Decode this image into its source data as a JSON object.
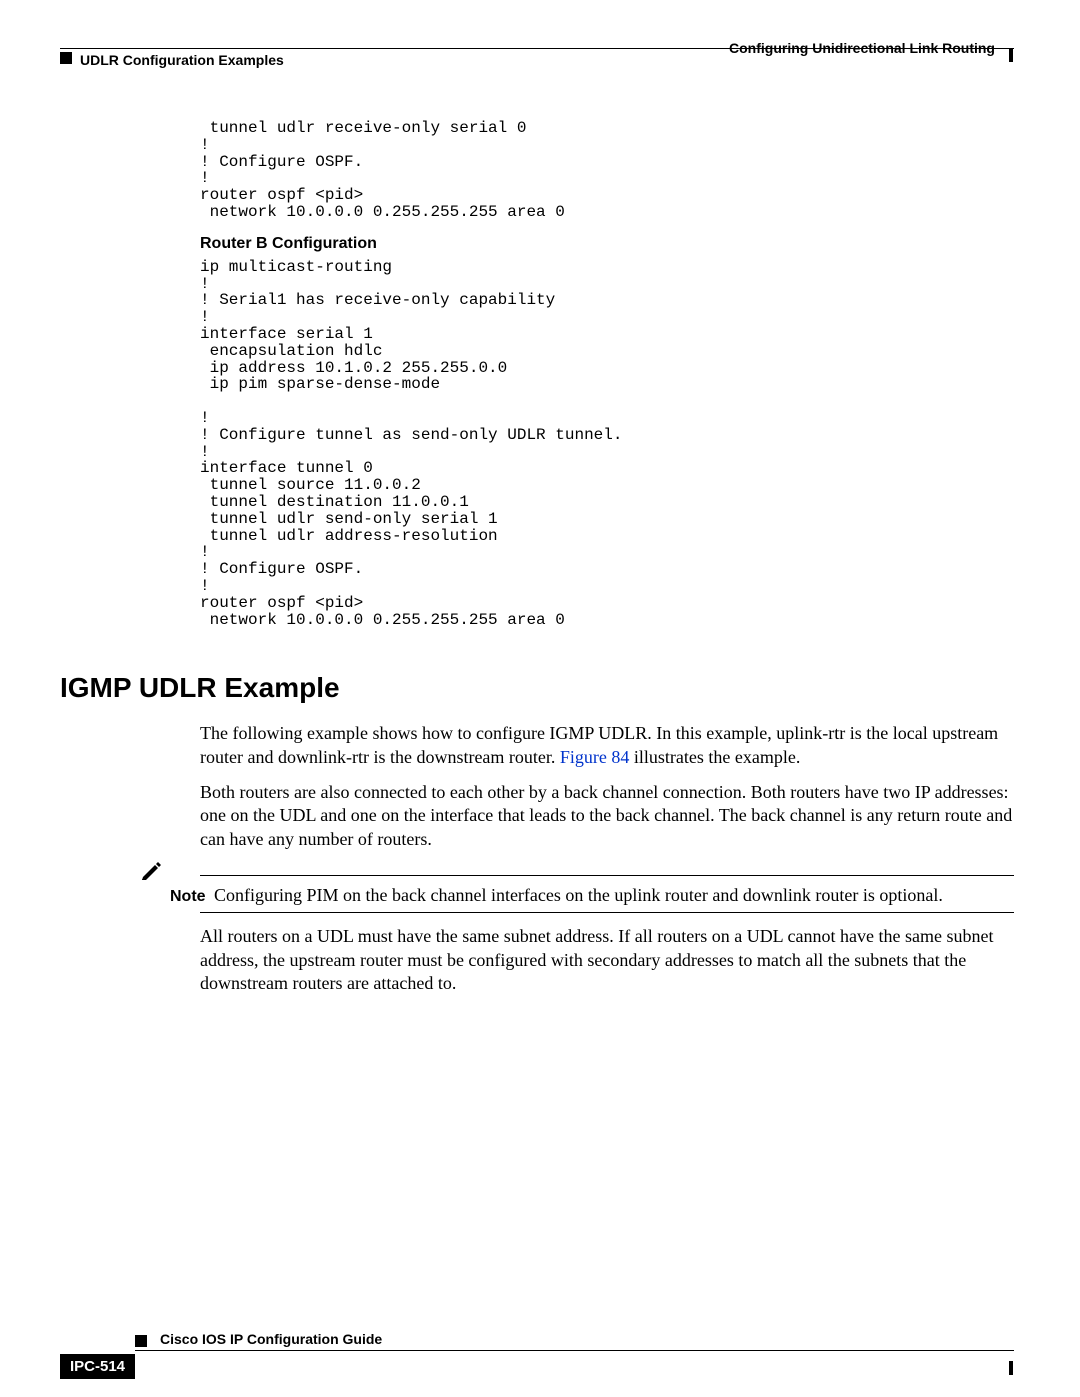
{
  "header": {
    "chapter": "Configuring Unidirectional Link Routing",
    "section": "UDLR Configuration Examples"
  },
  "code": {
    "blockA": " tunnel udlr receive-only serial 0\n!\n! Configure OSPF.\n!\nrouter ospf <pid>\n network 10.0.0.0 0.255.255.255 area 0",
    "routerB_heading": "Router B Configuration",
    "blockB": "ip multicast-routing\n!\n! Serial1 has receive-only capability\n!\ninterface serial 1\n encapsulation hdlc\n ip address 10.1.0.2 255.255.0.0\n ip pim sparse-dense-mode\n\n!\n! Configure tunnel as send-only UDLR tunnel.\n!\ninterface tunnel 0\n tunnel source 11.0.0.2\n tunnel destination 11.0.0.1\n tunnel udlr send-only serial 1\n tunnel udlr address-resolution\n!\n! Configure OSPF.\n!\nrouter ospf <pid>\n network 10.0.0.0 0.255.255.255 area 0"
  },
  "h1": "IGMP UDLR Example",
  "paras": {
    "p1a": "The following example shows how to configure IGMP UDLR. In this example, uplink-rtr is the local upstream router and downlink-rtr is the downstream router. ",
    "p1_link": "Figure 84",
    "p1b": " illustrates the example.",
    "p2": "Both routers are also connected to each other by a back channel connection. Both routers have two IP addresses: one on the UDL and one on the interface that leads to the back channel. The back channel is any return route and can have any number of routers.",
    "note_label": "Note",
    "note_text": "Configuring PIM on the back channel interfaces on the uplink router and downlink router is optional.",
    "p3": "All routers on a UDL must have the same subnet address. If all routers on a UDL cannot have the same subnet address, the upstream router must be configured with secondary addresses to match all the subnets that the downstream routers are attached to."
  },
  "footer": {
    "guide": "Cisco IOS IP Configuration Guide",
    "page": "IPC-514"
  }
}
